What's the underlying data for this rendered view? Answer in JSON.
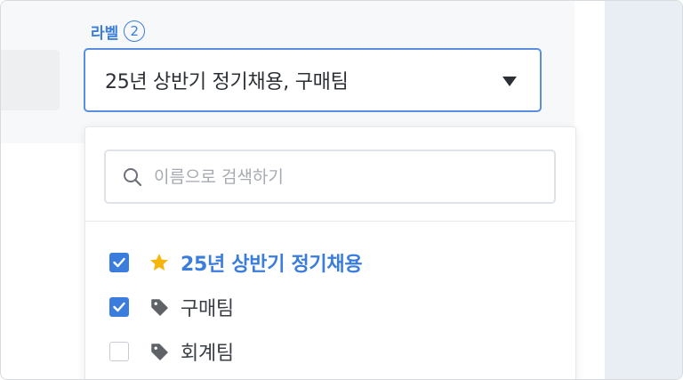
{
  "label_field": {
    "title": "라벨",
    "count": "2",
    "selected_value": "25년 상반기 정기채용, 구매팀"
  },
  "search": {
    "placeholder": "이름으로 검색하기",
    "value": ""
  },
  "options": [
    {
      "label": "25년 상반기 정기채용",
      "checked": true,
      "icon": "star-icon",
      "favorite": true
    },
    {
      "label": "구매팀",
      "checked": true,
      "icon": "tag-icon",
      "favorite": false
    },
    {
      "label": "회계팀",
      "checked": false,
      "icon": "tag-icon",
      "favorite": false
    }
  ],
  "colors": {
    "accent": "#3b7ddd",
    "star": "#f5b50a",
    "tag": "#5f6368"
  }
}
